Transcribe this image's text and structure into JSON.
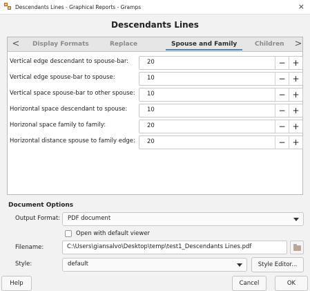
{
  "window": {
    "title": "Descendants Lines - Graphical Reports - Gramps",
    "close_glyph": "×"
  },
  "header": {
    "title": "Descendants Lines"
  },
  "tabs": {
    "prev_glyph": "<",
    "next_glyph": ">",
    "items": [
      {
        "label": "Display Formats"
      },
      {
        "label": "Replace"
      },
      {
        "label": "Spouse and Family",
        "active": true
      },
      {
        "label": "Children"
      }
    ]
  },
  "options": [
    {
      "label": "Vertical edge descendant to spouse-bar:",
      "value": "20"
    },
    {
      "label": "Vertical edge spouse-bar to spouse:",
      "value": "10"
    },
    {
      "label": "Vertical space spouse-bar to other spouse:",
      "value": "10"
    },
    {
      "label": "Horizontal space descendant to spouse:",
      "value": "10"
    },
    {
      "label": "Horizonal space family to family:",
      "value": "20"
    },
    {
      "label": "Horizontal distance spouse to family edge:",
      "value": "20"
    }
  ],
  "stepper": {
    "minus": "−",
    "plus": "+"
  },
  "document_options": {
    "title": "Document Options",
    "output_format_label": "Output Format:",
    "output_format_value": "PDF document",
    "open_viewer_label": "Open with default viewer",
    "open_viewer_checked": false,
    "filename_label": "Filename:",
    "filename_value": "C:\\Users\\giansalvo\\Desktop\\temp\\test1_Descendants Lines.pdf",
    "style_label": "Style:",
    "style_value": "default",
    "style_editor_label": "Style Editor..."
  },
  "buttons": {
    "help": "Help",
    "cancel": "Cancel",
    "ok": "OK"
  }
}
